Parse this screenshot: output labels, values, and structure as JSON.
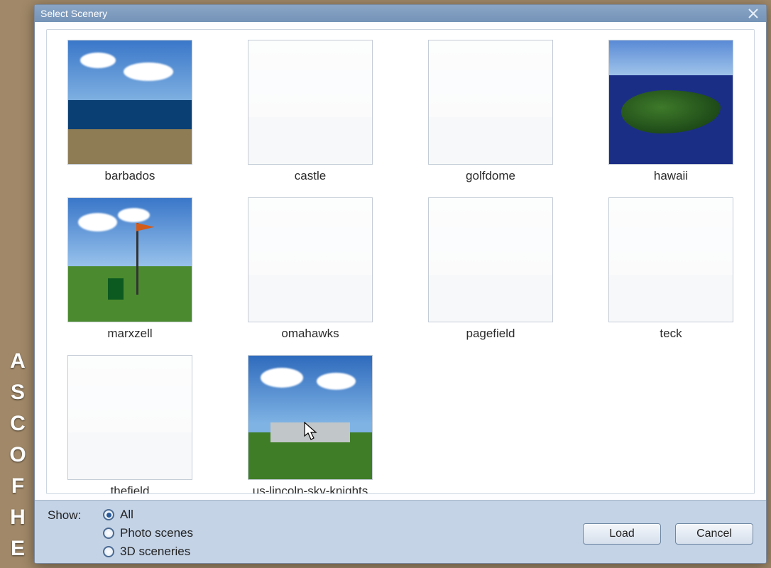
{
  "dialog": {
    "title": "Select Scenery"
  },
  "items": [
    {
      "label": "barbados",
      "art": "barbados",
      "dim": false
    },
    {
      "label": "castle",
      "art": "generic",
      "dim": true
    },
    {
      "label": "golfdome",
      "art": "generic",
      "dim": true
    },
    {
      "label": "hawaii",
      "art": "hawaii",
      "dim": false
    },
    {
      "label": "marxzell",
      "art": "marxzell",
      "dim": false
    },
    {
      "label": "omahawks",
      "art": "generic",
      "dim": true
    },
    {
      "label": "pagefield",
      "art": "generic",
      "dim": true
    },
    {
      "label": "teck",
      "art": "generic",
      "dim": true
    },
    {
      "label": "thefield",
      "art": "generic",
      "dim": true
    },
    {
      "label": "us-lincoln-sky-knights",
      "art": "sky",
      "dim": false
    }
  ],
  "filter": {
    "label": "Show:",
    "options": [
      {
        "label": "All",
        "checked": true
      },
      {
        "label": "Photo scenes",
        "checked": false
      },
      {
        "label": "3D sceneries",
        "checked": false
      }
    ]
  },
  "buttons": {
    "load": "Load",
    "cancel": "Cancel"
  },
  "bg_letters": [
    "A",
    "S",
    "C",
    "O",
    "F",
    "H",
    "E"
  ]
}
